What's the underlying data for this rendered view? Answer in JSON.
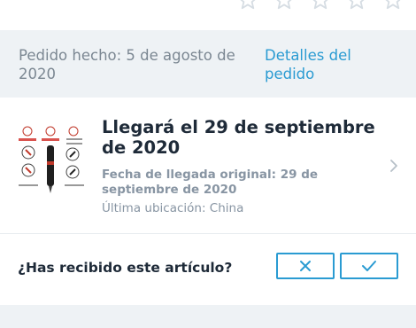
{
  "rating": {
    "icon": "star-outline-icon",
    "star_color": "#d6dde3"
  },
  "order": {
    "date_text": "Pedido hecho: 5 de agosto de 2020",
    "details_link": "Detalles del pedido"
  },
  "item": {
    "thumbnail_icon": "product-markers-thumbnail",
    "arrival_title": "Llegará el 29 de septiembre de 2020",
    "original_arrival": "Fecha de llegada original: 29 de septiembre de 2020",
    "last_location": "Última ubicación: China"
  },
  "received": {
    "question": "¿Has recibido este artículo?",
    "no_icon": "close-icon",
    "yes_icon": "check-icon"
  },
  "colors": {
    "accent": "#2a9bd2",
    "title": "#1e2a38",
    "muted": "#8895a3",
    "background": "#eef2f5"
  }
}
